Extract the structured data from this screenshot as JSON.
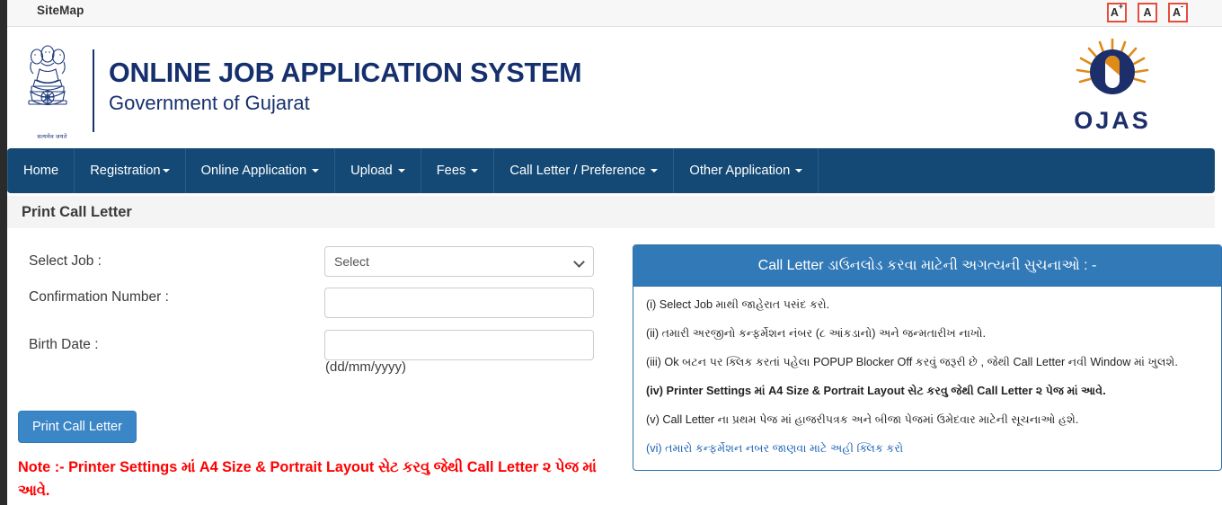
{
  "topbar": {
    "sitemap_label": "SiteMap",
    "font_controls": [
      {
        "name": "increase-font",
        "base": "A",
        "sup": "+"
      },
      {
        "name": "reset-font",
        "base": "A",
        "sup": ""
      },
      {
        "name": "decrease-font",
        "base": "A",
        "sup": "-"
      }
    ],
    "accent_color": "#e74c3c"
  },
  "header": {
    "title": "ONLINE JOB APPLICATION SYSTEM",
    "subtitle": "Government of Gujarat",
    "emblem_caption": "सत्यमेव जयते",
    "logo_text": "OJAS",
    "brand_color": "#16306e",
    "logo_accent": "#e08a18"
  },
  "nav": {
    "background_color": "#144975",
    "items": [
      {
        "label": "Home",
        "has_caret": false
      },
      {
        "label": "Registration",
        "has_caret": true
      },
      {
        "label": "Online Application",
        "has_caret": true
      },
      {
        "label": "Upload",
        "has_caret": true
      },
      {
        "label": "Fees",
        "has_caret": true
      },
      {
        "label": "Call Letter / Preference",
        "has_caret": true
      },
      {
        "label": "Other Application",
        "has_caret": true
      }
    ]
  },
  "page": {
    "title": "Print Call Letter"
  },
  "form": {
    "select_job_label": "Select Job :",
    "select_job_value": "Select",
    "select_job_options": [
      "Select"
    ],
    "confirmation_label": "Confirmation Number :",
    "confirmation_value": "",
    "birth_date_label": "Birth Date :",
    "birth_date_value": "",
    "birth_date_hint": "(dd/mm/yyyy)",
    "submit_label": "Print Call Letter",
    "submit_color": "#3b86c6",
    "note": "Note :- Printer Settings માં A4 Size & Portrait Layout સેટ કરવુ જેથી Call Letter ૨ પેજ માં આવે.",
    "note_color": "#ff0000"
  },
  "panel": {
    "header": "Call Letter ડાઉનલોડ કરવા માટેની અગત્યની સુચનાઓ : -",
    "header_color": "#3279b7",
    "items": [
      {
        "text": "(i) Select Job માથી જાહેરાત પસંદ કરો.",
        "bold": false,
        "link": false
      },
      {
        "text": "(ii) તમારી અરજીનો કન્ફર્મેશન નંબર (૮ આંકડાનો) અને જન્મતારીખ નાખો.",
        "bold": false,
        "link": false
      },
      {
        "text": "(iii) Ok બટન પર ક્લિક કરતાં પહેલા POPUP Blocker Off કરવું જરૂરી છે , જેથી Call Letter નવી Window માં ખુલશે.",
        "bold": false,
        "link": false
      },
      {
        "text": "(iv) Printer Settings માં A4 Size & Portrait Layout સેટ કરવુ જેથી Call Letter ૨ પેજ માં આવે.",
        "bold": true,
        "link": false
      },
      {
        "text": "(v) Call Letter ના પ્રથમ પેજ માં હાજરીપત્રક અને બીજા પેજમાં ઉમેદવાર માટેની સૂચનાઓ હશે.",
        "bold": false,
        "link": false
      },
      {
        "text": "(vi) તમારો કન્ફર્મેશન નબર જાણવા માટે અહી ક્લિક કરો",
        "bold": false,
        "link": true
      }
    ]
  }
}
